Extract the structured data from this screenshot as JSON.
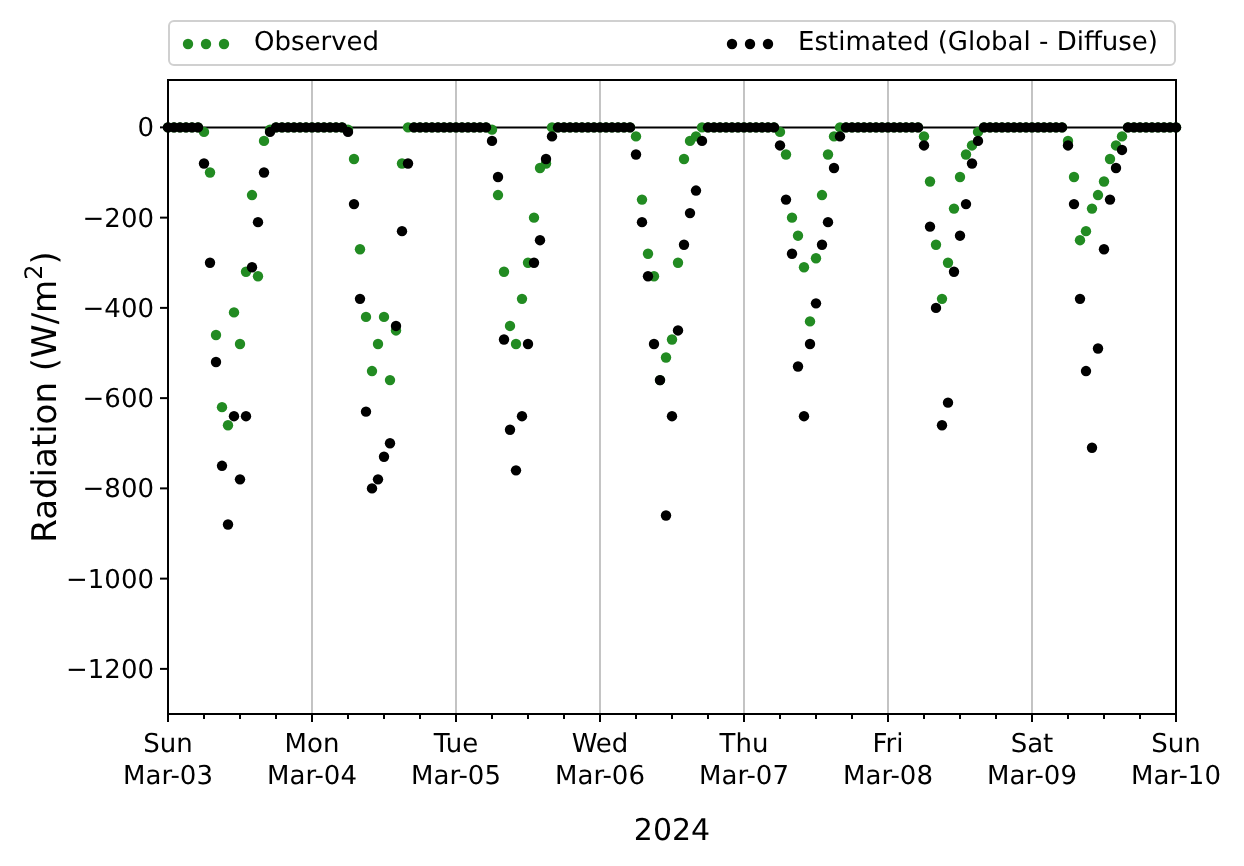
{
  "chart_data": {
    "type": "scatter",
    "xlabel": "2024",
    "ylabel": "Radiation (W/m$^{2}$)",
    "ylim": [
      -1300,
      105
    ],
    "yticks": [
      {
        "value": 0,
        "label": "0"
      },
      {
        "value": -200,
        "label": "−200"
      },
      {
        "value": -400,
        "label": "−400"
      },
      {
        "value": -600,
        "label": "−600"
      },
      {
        "value": -800,
        "label": "−800"
      },
      {
        "value": -1000,
        "label": "−1000"
      },
      {
        "value": -1200,
        "label": "−1200"
      }
    ],
    "categories": [
      "Sun\nMar-03",
      null,
      null,
      null,
      null,
      null,
      null,
      null,
      null,
      null,
      null,
      null,
      null,
      null,
      null,
      null,
      null,
      null,
      null,
      null,
      null,
      null,
      null,
      null,
      "Mon\nMar-04",
      null,
      null,
      null,
      null,
      null,
      null,
      null,
      null,
      null,
      null,
      null,
      null,
      null,
      null,
      null,
      null,
      null,
      null,
      null,
      null,
      null,
      null,
      null,
      "Tue\nMar-05",
      null,
      null,
      null,
      null,
      null,
      null,
      null,
      null,
      null,
      null,
      null,
      null,
      null,
      null,
      null,
      null,
      null,
      null,
      null,
      null,
      null,
      null,
      null,
      "Wed\nMar-06",
      null,
      null,
      null,
      null,
      null,
      null,
      null,
      null,
      null,
      null,
      null,
      null,
      null,
      null,
      null,
      null,
      null,
      null,
      null,
      null,
      null,
      null,
      null,
      "Thu\nMar-07",
      null,
      null,
      null,
      null,
      null,
      null,
      null,
      null,
      null,
      null,
      null,
      null,
      null,
      null,
      null,
      null,
      null,
      null,
      null,
      null,
      null,
      null,
      null,
      "Fri\nMar-08",
      null,
      null,
      null,
      null,
      null,
      null,
      null,
      null,
      null,
      null,
      null,
      null,
      null,
      null,
      null,
      null,
      null,
      null,
      null,
      null,
      null,
      null,
      null,
      "Sat\nMar-09",
      null,
      null,
      null,
      null,
      null,
      null,
      null,
      null,
      null,
      null,
      null,
      null,
      null,
      null,
      null,
      null,
      null,
      null,
      null,
      null,
      null,
      null,
      null,
      "Sun\nMar-10"
    ],
    "series": [
      {
        "name": "Observed",
        "color": "#228b22",
        "values": [
          0,
          0,
          0,
          0,
          0,
          0,
          -10,
          -100,
          -460,
          -620,
          -660,
          -410,
          -480,
          -320,
          -150,
          -330,
          -30,
          -5,
          0,
          0,
          0,
          0,
          0,
          0,
          0,
          0,
          0,
          0,
          0,
          0,
          -5,
          -70,
          -270,
          -420,
          -540,
          -480,
          -420,
          -560,
          -450,
          -80,
          0,
          0,
          0,
          0,
          0,
          0,
          0,
          0,
          0,
          0,
          0,
          0,
          0,
          0,
          -5,
          -150,
          -320,
          -440,
          -480,
          -380,
          -300,
          -200,
          -90,
          -80,
          0,
          0,
          0,
          0,
          0,
          0,
          0,
          0,
          0,
          0,
          0,
          0,
          0,
          0,
          -20,
          -160,
          -280,
          -330,
          -560,
          -510,
          -470,
          -300,
          -70,
          -30,
          -20,
          0,
          0,
          0,
          0,
          0,
          0,
          0,
          0,
          0,
          0,
          0,
          0,
          0,
          -10,
          -60,
          -200,
          -240,
          -310,
          -430,
          -290,
          -150,
          -60,
          -20,
          0,
          0,
          0,
          0,
          0,
          0,
          0,
          0,
          0,
          0,
          0,
          0,
          0,
          0,
          -20,
          -120,
          -260,
          -380,
          -300,
          -180,
          -110,
          -60,
          -40,
          -10,
          0,
          0,
          0,
          0,
          0,
          0,
          0,
          0,
          0,
          0,
          0,
          0,
          0,
          0,
          -30,
          -110,
          -250,
          -230,
          -180,
          -150,
          -120,
          -70,
          -40,
          -20,
          0,
          0,
          0,
          0,
          0,
          0,
          0,
          0,
          0
        ]
      },
      {
        "name": "Estimated (Global - Diffuse)",
        "color": "#000000",
        "values": [
          0,
          0,
          0,
          0,
          0,
          0,
          -80,
          -300,
          -520,
          -750,
          -880,
          -640,
          -780,
          -640,
          -310,
          -210,
          -100,
          -10,
          0,
          0,
          0,
          0,
          0,
          0,
          0,
          0,
          0,
          0,
          0,
          0,
          -10,
          -170,
          -380,
          -630,
          -800,
          -780,
          -730,
          -700,
          -440,
          -230,
          -80,
          0,
          0,
          0,
          0,
          0,
          0,
          0,
          0,
          0,
          0,
          0,
          0,
          0,
          -30,
          -110,
          -470,
          -670,
          -760,
          -640,
          -480,
          -300,
          -250,
          -70,
          -20,
          0,
          0,
          0,
          0,
          0,
          0,
          0,
          0,
          0,
          0,
          0,
          0,
          0,
          -60,
          -210,
          -330,
          -480,
          -560,
          -860,
          -640,
          -450,
          -260,
          -190,
          -140,
          -30,
          0,
          0,
          0,
          0,
          0,
          0,
          0,
          0,
          0,
          0,
          0,
          0,
          -40,
          -160,
          -280,
          -530,
          -640,
          -480,
          -390,
          -260,
          -210,
          -90,
          -20,
          0,
          0,
          0,
          0,
          0,
          0,
          0,
          0,
          0,
          0,
          0,
          0,
          0,
          -40,
          -220,
          -400,
          -660,
          -610,
          -320,
          -240,
          -170,
          -80,
          -30,
          0,
          0,
          0,
          0,
          0,
          0,
          0,
          0,
          0,
          0,
          0,
          0,
          0,
          0,
          -40,
          -170,
          -380,
          -540,
          -710,
          -490,
          -270,
          -160,
          -90,
          -50,
          0,
          0,
          0,
          0,
          0,
          0,
          0,
          0,
          0
        ]
      }
    ]
  }
}
